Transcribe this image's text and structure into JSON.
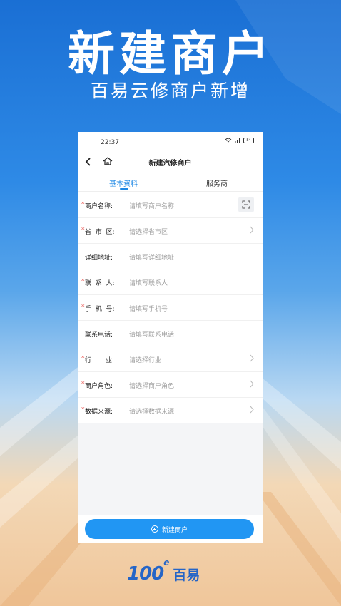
{
  "hero": {
    "title": "新建商户",
    "subtitle": "百易云修商户新增"
  },
  "status_bar": {
    "time": "22:37",
    "battery": "84"
  },
  "nav": {
    "title": "新建汽修商户"
  },
  "tabs": [
    {
      "label": "基本资料",
      "active": true
    },
    {
      "label": "服务商",
      "active": false
    }
  ],
  "form": {
    "rows": [
      {
        "label": "商户名称:",
        "placeholder": "请填写商户名称",
        "required": true,
        "action": "scan"
      },
      {
        "label": "省  市  区:",
        "placeholder": "请选择省市区",
        "required": true,
        "action": "chevron"
      },
      {
        "label": "详细地址:",
        "placeholder": "请填写详细地址",
        "required": false,
        "action": "none"
      },
      {
        "label": "联  系  人:",
        "placeholder": "请填写联系人",
        "required": true,
        "action": "none"
      },
      {
        "label": "手  机  号:",
        "placeholder": "请填写手机号",
        "required": true,
        "action": "none"
      },
      {
        "label": "联系电话:",
        "placeholder": "请填写联系电话",
        "required": false,
        "action": "none"
      },
      {
        "label": "行       业:",
        "placeholder": "请选择行业",
        "required": true,
        "action": "chevron"
      },
      {
        "label": "商户角色:",
        "placeholder": "请选择商户角色",
        "required": true,
        "action": "chevron"
      },
      {
        "label": "数据来源:",
        "placeholder": "请选择数据来源",
        "required": true,
        "action": "chevron"
      }
    ]
  },
  "footer": {
    "create_label": "新建商户"
  },
  "brand": {
    "logo": "100",
    "logo_sup": "e",
    "name": "百易"
  },
  "colors": {
    "accent": "#2196f3",
    "required": "#e53935",
    "brand": "#2565c7"
  }
}
